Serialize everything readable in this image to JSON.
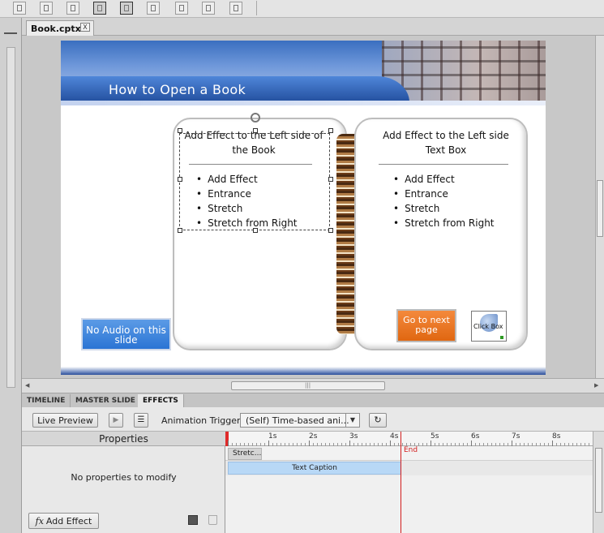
{
  "document_tab": {
    "label": "Book.cptx*",
    "close_glyph": "X"
  },
  "slide": {
    "title": "How to Open a Book",
    "left_page": {
      "heading": "Add Effect to the Left side of the Book",
      "items": [
        "Add Effect",
        "Entrance",
        "Stretch",
        "Stretch from Right"
      ]
    },
    "right_page": {
      "heading": "Add Effect to the Left side Text Box",
      "items": [
        "Add Effect",
        "Entrance",
        "Stretch",
        "Stretch from Right"
      ]
    },
    "no_audio_button": "No Audio on this slide",
    "next_page_button": "Go to next page",
    "click_box_label": "Click Box",
    "colors": {
      "banner_blue": "#2a5fb4",
      "next_button_orange": "#e96f1b",
      "audio_button_blue": "#3b82dc"
    }
  },
  "panel_tabs": [
    "TIMELINE",
    "MASTER SLIDE",
    "EFFECTS"
  ],
  "active_panel_tab": "EFFECTS",
  "effects_toolbar": {
    "live_preview": "Live Preview",
    "animation_trigger_label": "Animation Trigger:",
    "animation_trigger_value": "(Self) Time-based ani...",
    "dropdown_glyph": "▼"
  },
  "properties": {
    "header": "Properties",
    "empty_message": "No properties to modify",
    "add_effect_button": "Add Effect",
    "fx_glyph": "fx"
  },
  "timeline": {
    "ruler_labels": [
      "1s",
      "2s",
      "3s",
      "4s",
      "5s",
      "6s",
      "7s",
      "8s"
    ],
    "stretch_block": "Stretc...",
    "caption_block": "Text Caption",
    "end_label": "End",
    "icons": [
      "save-icon",
      "delete-icon",
      "play-icon",
      "effects-list-icon",
      "refresh-icon"
    ]
  }
}
